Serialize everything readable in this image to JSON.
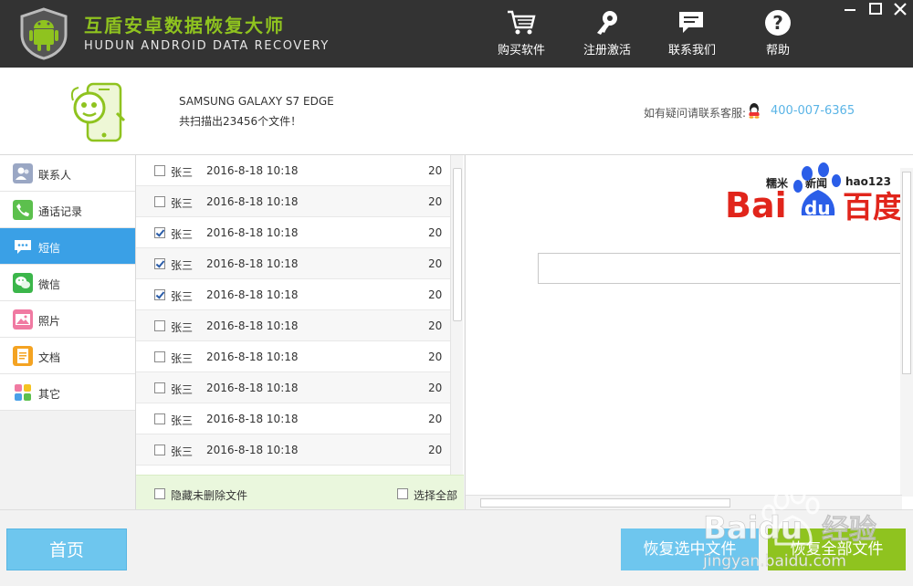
{
  "app": {
    "title_cn": "互盾安卓数据恢复大师",
    "title_en": "HUDUN ANDROID DATA RECOVERY"
  },
  "toolbar": {
    "buy": "购买软件",
    "register": "注册激活",
    "contact": "联系我们",
    "help": "帮助"
  },
  "device": {
    "name": "SAMSUNG GALAXY S7 EDGE",
    "scan_summary": "共扫描出23456个文件！",
    "support_label": "如有疑问请联系客服:",
    "support_phone": "400-007-6365"
  },
  "sidebar": {
    "items": [
      {
        "label": "联系人",
        "icon": "contacts-icon",
        "color": "#9aa7c4"
      },
      {
        "label": "通话记录",
        "icon": "call-log-icon",
        "color": "#5cc04d"
      },
      {
        "label": "短信",
        "icon": "sms-icon",
        "color": "#ffffff"
      },
      {
        "label": "微信",
        "icon": "wechat-icon",
        "color": "#3bb64a"
      },
      {
        "label": "照片",
        "icon": "photos-icon",
        "color": "#f07aa2"
      },
      {
        "label": "文档",
        "icon": "document-icon",
        "color": "#f4a322"
      },
      {
        "label": "其它",
        "icon": "other-icon",
        "color": "#4aa0e8"
      }
    ],
    "active_index": 2
  },
  "list": {
    "rows": [
      {
        "name": "张三",
        "date": "2016-8-18 10:18",
        "count": "20",
        "checked": false
      },
      {
        "name": "张三",
        "date": "2016-8-18 10:18",
        "count": "20",
        "checked": false
      },
      {
        "name": "张三",
        "date": "2016-8-18 10:18",
        "count": "20",
        "checked": true
      },
      {
        "name": "张三",
        "date": "2016-8-18 10:18",
        "count": "20",
        "checked": true
      },
      {
        "name": "张三",
        "date": "2016-8-18 10:18",
        "count": "20",
        "checked": true
      },
      {
        "name": "张三",
        "date": "2016-8-18 10:18",
        "count": "20",
        "checked": false
      },
      {
        "name": "张三",
        "date": "2016-8-18 10:18",
        "count": "20",
        "checked": false
      },
      {
        "name": "张三",
        "date": "2016-8-18 10:18",
        "count": "20",
        "checked": false
      },
      {
        "name": "张三",
        "date": "2016-8-18 10:18",
        "count": "20",
        "checked": false
      },
      {
        "name": "张三",
        "date": "2016-8-18 10:18",
        "count": "20",
        "checked": false
      }
    ],
    "hide_undeleted": "隐藏未删除文件",
    "select_all": "选择全部"
  },
  "preview": {
    "links": [
      "糯米",
      "新闻",
      "hao123"
    ],
    "logo_text_left": "Bai",
    "logo_text_mid": "du",
    "logo_text_right": "百度"
  },
  "buttons": {
    "home": "首页",
    "recover_selected": "恢复选中文件",
    "recover_all": "恢复全部文件"
  },
  "watermark": {
    "text1": "Baidu",
    "text2": "经验",
    "url": "jingyan.baidu.com"
  },
  "colors": {
    "titlebar": "#333333",
    "brand_green": "#8fc31f",
    "accent_blue": "#3aa0e6",
    "button_blue": "#6ec6ee"
  }
}
